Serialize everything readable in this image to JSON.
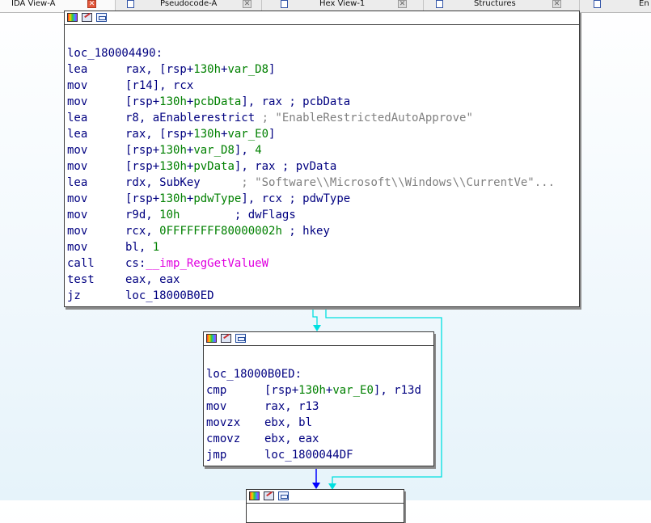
{
  "tabs": [
    {
      "label": "IDA View-A",
      "active": true,
      "icon": "ida-view-icon"
    },
    {
      "label": "Pseudocode-A",
      "active": false,
      "icon": "pseudocode-icon"
    },
    {
      "label": "Hex View-1",
      "active": false,
      "icon": "hex-view-icon"
    },
    {
      "label": "Structures",
      "active": false,
      "icon": "structures-icon"
    },
    {
      "label": "En",
      "active": false,
      "icon": "enums-icon"
    }
  ],
  "blocks": {
    "b1": {
      "label": "loc_180004490:",
      "lines": [
        [
          {
            "t": "lea"
          },
          {
            "t": "rax, [rsp+"
          },
          {
            "t": "130h",
            "c": "g"
          },
          {
            "t": "+"
          },
          {
            "t": "var_D8",
            "c": "g"
          },
          {
            "t": "]"
          }
        ],
        [
          {
            "t": "mov"
          },
          {
            "t": "[r14], rcx"
          }
        ],
        [
          {
            "t": "mov"
          },
          {
            "t": "[rsp+"
          },
          {
            "t": "130h",
            "c": "g"
          },
          {
            "t": "+"
          },
          {
            "t": "pcbData",
            "c": "g"
          },
          {
            "t": "], rax ; pcbData"
          }
        ],
        [
          {
            "t": "lea"
          },
          {
            "t": "r8, aEnablerestrict "
          },
          {
            "t": "; \"EnableRestrictedAutoApprove\"",
            "c": "cm"
          }
        ],
        [
          {
            "t": "lea"
          },
          {
            "t": "rax, [rsp+"
          },
          {
            "t": "130h",
            "c": "g"
          },
          {
            "t": "+"
          },
          {
            "t": "var_E0",
            "c": "g"
          },
          {
            "t": "]"
          }
        ],
        [
          {
            "t": "mov"
          },
          {
            "t": "[rsp+"
          },
          {
            "t": "130h",
            "c": "g"
          },
          {
            "t": "+"
          },
          {
            "t": "var_D8",
            "c": "g"
          },
          {
            "t": "], "
          },
          {
            "t": "4",
            "c": "g"
          }
        ],
        [
          {
            "t": "mov"
          },
          {
            "t": "[rsp+"
          },
          {
            "t": "130h",
            "c": "g"
          },
          {
            "t": "+"
          },
          {
            "t": "pvData",
            "c": "g"
          },
          {
            "t": "], rax ; pvData"
          }
        ],
        [
          {
            "t": "lea"
          },
          {
            "t": "rdx, SubKey      "
          },
          {
            "t": "; \"Software\\\\Microsoft\\\\Windows\\\\CurrentVe\"...",
            "c": "cm"
          }
        ],
        [
          {
            "t": "mov"
          },
          {
            "t": "[rsp+"
          },
          {
            "t": "130h",
            "c": "g"
          },
          {
            "t": "+"
          },
          {
            "t": "pdwType",
            "c": "g"
          },
          {
            "t": "], rcx ; pdwType"
          }
        ],
        [
          {
            "t": "mov"
          },
          {
            "t": "r9d, "
          },
          {
            "t": "10h",
            "c": "g"
          },
          {
            "t": "        ; dwFlags"
          }
        ],
        [
          {
            "t": "mov"
          },
          {
            "t": "rcx, "
          },
          {
            "t": "0FFFFFFFF80000002h",
            "c": "g"
          },
          {
            "t": " ; hkey"
          }
        ],
        [
          {
            "t": "mov"
          },
          {
            "t": "bl, "
          },
          {
            "t": "1",
            "c": "g"
          }
        ],
        [
          {
            "t": "call"
          },
          {
            "t": "cs:"
          },
          {
            "t": "__imp_RegGetValueW",
            "c": "mg"
          }
        ],
        [
          {
            "t": "test"
          },
          {
            "t": "eax, eax"
          }
        ],
        [
          {
            "t": "jz"
          },
          {
            "t": "loc_18000B0ED"
          }
        ]
      ]
    },
    "b2": {
      "label": "loc_18000B0ED:",
      "lines": [
        [
          {
            "t": "cmp"
          },
          {
            "t": "[rsp+"
          },
          {
            "t": "130h",
            "c": "g"
          },
          {
            "t": "+"
          },
          {
            "t": "var_E0",
            "c": "g"
          },
          {
            "t": "], r13d"
          }
        ],
        [
          {
            "t": "mov"
          },
          {
            "t": "rax, r13"
          }
        ],
        [
          {
            "t": "movzx"
          },
          {
            "t": "ebx, bl"
          }
        ],
        [
          {
            "t": "cmovz"
          },
          {
            "t": "ebx, eax"
          }
        ],
        [
          {
            "t": "jmp"
          },
          {
            "t": "loc_1800044DF"
          }
        ]
      ]
    },
    "b3": {
      "label": "",
      "lines": []
    }
  },
  "colors": {
    "mnemonic": "#000080",
    "number": "#008000",
    "comment": "#808080",
    "import": "#e000e0",
    "edge_true": "#00e0e0",
    "edge_jump": "#0000ff"
  }
}
